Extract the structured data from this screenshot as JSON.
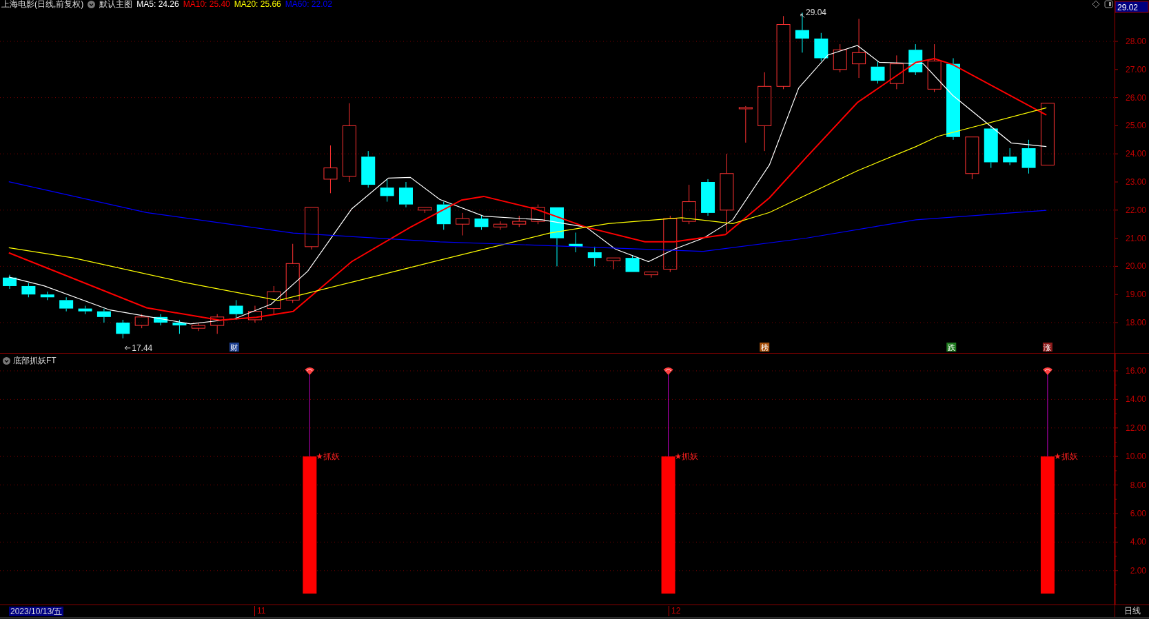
{
  "chart": {
    "title": "上海电影(日线,前复权)",
    "template": "默认主图",
    "ma": [
      {
        "label": "MA5: 24.26",
        "color": "#ffffff"
      },
      {
        "label": "MA10: 25.40",
        "color": "#ff0000"
      },
      {
        "label": "MA20: 25.66",
        "color": "#ffff00"
      },
      {
        "label": "MA60: 22.02",
        "color": "#0000ff"
      }
    ],
    "current_price": "29.02",
    "high_label": "29.04",
    "low_label": "17.44",
    "price_ticks": [
      "28.00",
      "27.00",
      "26.00",
      "25.00",
      "24.00",
      "23.00",
      "22.00",
      "21.00",
      "20.00",
      "19.00",
      "18.00"
    ],
    "event_markers": [
      {
        "label": "财",
        "color": "#1d3f8f"
      },
      {
        "label": "榜",
        "color": "#a8520e"
      },
      {
        "label": "跌",
        "color": "#1f7a1f"
      },
      {
        "label": "涨",
        "color": "#8a1a1a"
      }
    ]
  },
  "indicator": {
    "title": "底部抓妖FT",
    "ticks": [
      "16.00",
      "14.00",
      "12.00",
      "10.00",
      "8.00",
      "6.00",
      "4.00",
      "2.00"
    ],
    "signals": [
      {
        "label": "★抓妖"
      },
      {
        "label": "★抓妖"
      },
      {
        "label": "★抓妖"
      }
    ]
  },
  "time_axis": {
    "date": "2023/10/13/五",
    "months": [
      "11",
      "12"
    ],
    "period": "日线"
  }
}
